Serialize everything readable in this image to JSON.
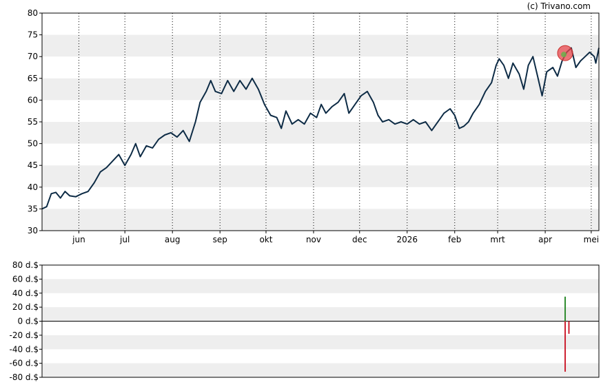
{
  "credit": "(c) Trivano.com",
  "colors": {
    "line": "#0d2b45",
    "band": "#eeeeee",
    "marker_fill": "#e8474c",
    "marker_inner": "#6ab04c",
    "bar_up": "#2e8b2e",
    "bar_down": "#cc1f2f"
  },
  "chart_data": [
    {
      "type": "line",
      "title": "",
      "ylim": [
        30,
        80
      ],
      "yticks": [
        30,
        35,
        40,
        45,
        50,
        55,
        60,
        65,
        70,
        75,
        80
      ],
      "xlim": [
        "2025-05-08",
        "2026-05-06"
      ],
      "xticks": [
        {
          "date": "2025-06-01",
          "label": "jun"
        },
        {
          "date": "2025-07-01",
          "label": "jul"
        },
        {
          "date": "2025-08-01",
          "label": "aug"
        },
        {
          "date": "2025-09-01",
          "label": "sep"
        },
        {
          "date": "2025-10-01",
          "label": "okt"
        },
        {
          "date": "2025-11-01",
          "label": "nov"
        },
        {
          "date": "2025-12-01",
          "label": "dec"
        },
        {
          "date": "2026-01-01",
          "label": "2026"
        },
        {
          "date": "2026-02-01",
          "label": "feb"
        },
        {
          "date": "2026-03-01",
          "label": "mrt"
        },
        {
          "date": "2026-04-01",
          "label": "apr"
        },
        {
          "date": "2026-05-01",
          "label": "mei"
        }
      ],
      "grid": "vertical dotted at month ticks; alternating horizontal bands",
      "series": [
        {
          "points": [
            [
              "2025-05-08",
              35.0
            ],
            [
              "2025-05-11",
              35.5
            ],
            [
              "2025-05-14",
              38.5
            ],
            [
              "2025-05-17",
              38.8
            ],
            [
              "2025-05-20",
              37.5
            ],
            [
              "2025-05-23",
              39.0
            ],
            [
              "2025-05-26",
              38.0
            ],
            [
              "2025-05-30",
              37.8
            ],
            [
              "2025-06-03",
              38.5
            ],
            [
              "2025-06-07",
              39.0
            ],
            [
              "2025-06-11",
              41.0
            ],
            [
              "2025-06-15",
              43.5
            ],
            [
              "2025-06-19",
              44.5
            ],
            [
              "2025-06-23",
              46.0
            ],
            [
              "2025-06-27",
              47.5
            ],
            [
              "2025-07-01",
              45.0
            ],
            [
              "2025-07-05",
              47.5
            ],
            [
              "2025-07-08",
              50.0
            ],
            [
              "2025-07-11",
              47.0
            ],
            [
              "2025-07-15",
              49.5
            ],
            [
              "2025-07-19",
              49.0
            ],
            [
              "2025-07-23",
              51.0
            ],
            [
              "2025-07-27",
              52.0
            ],
            [
              "2025-07-31",
              52.5
            ],
            [
              "2025-08-04",
              51.5
            ],
            [
              "2025-08-08",
              53.0
            ],
            [
              "2025-08-12",
              50.5
            ],
            [
              "2025-08-16",
              55.0
            ],
            [
              "2025-08-19",
              59.5
            ],
            [
              "2025-08-23",
              62.0
            ],
            [
              "2025-08-26",
              64.5
            ],
            [
              "2025-08-29",
              62.0
            ],
            [
              "2025-09-02",
              61.5
            ],
            [
              "2025-09-06",
              64.5
            ],
            [
              "2025-09-10",
              62.0
            ],
            [
              "2025-09-14",
              64.5
            ],
            [
              "2025-09-18",
              62.5
            ],
            [
              "2025-09-22",
              65.0
            ],
            [
              "2025-09-26",
              62.5
            ],
            [
              "2025-09-30",
              59.0
            ],
            [
              "2025-10-04",
              56.5
            ],
            [
              "2025-10-08",
              56.0
            ],
            [
              "2025-10-11",
              53.5
            ],
            [
              "2025-10-14",
              57.5
            ],
            [
              "2025-10-18",
              54.5
            ],
            [
              "2025-10-22",
              55.5
            ],
            [
              "2025-10-26",
              54.5
            ],
            [
              "2025-10-30",
              57.0
            ],
            [
              "2025-11-03",
              56.0
            ],
            [
              "2025-11-06",
              59.0
            ],
            [
              "2025-11-09",
              57.0
            ],
            [
              "2025-11-13",
              58.5
            ],
            [
              "2025-11-17",
              59.5
            ],
            [
              "2025-11-21",
              61.5
            ],
            [
              "2025-11-24",
              57.0
            ],
            [
              "2025-11-28",
              59.0
            ],
            [
              "2025-12-02",
              61.0
            ],
            [
              "2025-12-06",
              62.0
            ],
            [
              "2025-12-10",
              59.5
            ],
            [
              "2025-12-13",
              56.5
            ],
            [
              "2025-12-16",
              55.0
            ],
            [
              "2025-12-20",
              55.5
            ],
            [
              "2025-12-24",
              54.5
            ],
            [
              "2025-12-28",
              55.0
            ],
            [
              "2026-01-01",
              54.5
            ],
            [
              "2026-01-05",
              55.5
            ],
            [
              "2026-01-09",
              54.5
            ],
            [
              "2026-01-13",
              55.0
            ],
            [
              "2026-01-17",
              53.0
            ],
            [
              "2026-01-21",
              55.0
            ],
            [
              "2026-01-25",
              57.0
            ],
            [
              "2026-01-29",
              58.0
            ],
            [
              "2026-02-01",
              56.5
            ],
            [
              "2026-02-04",
              53.5
            ],
            [
              "2026-02-07",
              54.0
            ],
            [
              "2026-02-10",
              55.0
            ],
            [
              "2026-02-13",
              57.0
            ],
            [
              "2026-02-17",
              59.0
            ],
            [
              "2026-02-21",
              62.0
            ],
            [
              "2026-02-25",
              64.0
            ],
            [
              "2026-02-28",
              68.0
            ],
            [
              "2026-03-02",
              69.5
            ],
            [
              "2026-03-05",
              68.0
            ],
            [
              "2026-03-08",
              65.0
            ],
            [
              "2026-03-11",
              68.5
            ],
            [
              "2026-03-15",
              66.0
            ],
            [
              "2026-03-18",
              62.5
            ],
            [
              "2026-03-21",
              68.0
            ],
            [
              "2026-03-24",
              70.0
            ],
            [
              "2026-03-27",
              65.5
            ],
            [
              "2026-03-30",
              61.0
            ],
            [
              "2026-04-02",
              66.5
            ],
            [
              "2026-04-06",
              67.5
            ],
            [
              "2026-04-09",
              65.5
            ],
            [
              "2026-04-12",
              69.0
            ],
            [
              "2026-04-15",
              71.0
            ],
            [
              "2026-04-18",
              72.0
            ],
            [
              "2026-04-21",
              67.5
            ],
            [
              "2026-04-24",
              69.0
            ],
            [
              "2026-04-27",
              70.0
            ],
            [
              "2026-04-30",
              71.0
            ],
            [
              "2026-05-03",
              70.0
            ],
            [
              "2026-05-04",
              68.5
            ],
            [
              "2026-05-06",
              72.0
            ]
          ]
        }
      ],
      "marker": {
        "date": "2026-04-14",
        "value": 70.8
      }
    },
    {
      "type": "bar",
      "ylim": [
        -80,
        80
      ],
      "yticks": [
        {
          "value": 80,
          "label": "80 d.$"
        },
        {
          "value": 60,
          "label": "60 d.$"
        },
        {
          "value": 40,
          "label": "40 d.$"
        },
        {
          "value": 20,
          "label": "20 d.$"
        },
        {
          "value": 0,
          "label": "0 d.$"
        },
        {
          "value": -20,
          "label": "-20 d.$"
        },
        {
          "value": -40,
          "label": "-40 d.$"
        },
        {
          "value": -60,
          "label": "-60 d.$"
        },
        {
          "value": -80,
          "label": "-80 d.$"
        }
      ],
      "bars": [
        {
          "date": "2026-04-14",
          "value": 35
        },
        {
          "date": "2026-04-14",
          "value": -72
        },
        {
          "date": "2026-04-16",
          "value": -18
        }
      ]
    }
  ]
}
